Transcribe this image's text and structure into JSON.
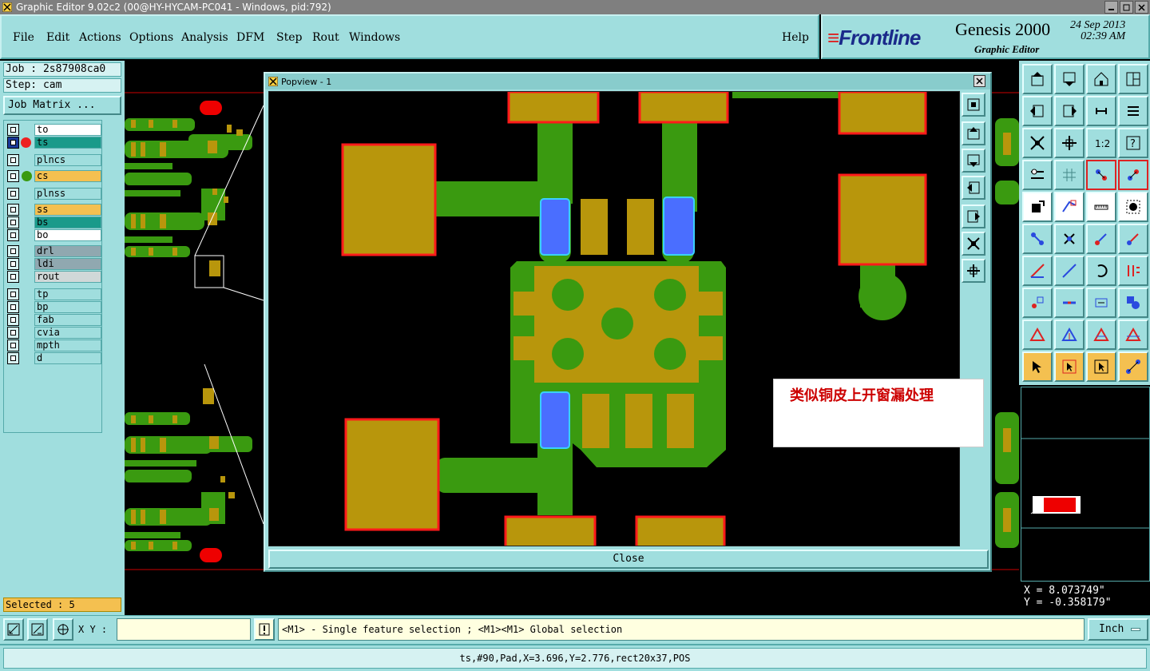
{
  "window": {
    "title": "Graphic Editor 9.02c2 (00@HY-HYCAM-PC041 - Windows, pid:792)"
  },
  "menu": {
    "items": [
      "File",
      "Edit",
      "Actions",
      "Options",
      "Analysis",
      "DFM",
      "Step",
      "Rout",
      "Windows"
    ],
    "help": "Help"
  },
  "brand": {
    "logo": "Frontline",
    "product": "Genesis 2000",
    "date": "24 Sep 2013",
    "time": "02:39 AM",
    "subtitle": "Graphic Editor"
  },
  "job": {
    "job_label": "Job : 2s87908ca0",
    "step_label": "Step: cam",
    "matrix_button": "Job Matrix ..."
  },
  "layers": [
    {
      "name": "to",
      "color": "#ffffff"
    },
    {
      "name": "ts",
      "color": "#1a9a8a",
      "active": true
    },
    {
      "name": "plncs",
      "color": "#a0dede"
    },
    {
      "name": "cs",
      "color": "#f4c050"
    },
    {
      "name": "plnss",
      "color": "#a0dede"
    },
    {
      "name": "ss",
      "color": "#f4c050"
    },
    {
      "name": "bs",
      "color": "#1a9a8a"
    },
    {
      "name": "bo",
      "color": "#ffffff"
    },
    {
      "name": "drl",
      "color": "#90a8b0"
    },
    {
      "name": "ldi",
      "color": "#90a8b0"
    },
    {
      "name": "rout",
      "color": "#d0d8d8"
    },
    {
      "name": "tp",
      "color": "#a0dede"
    },
    {
      "name": "bp",
      "color": "#a0dede"
    },
    {
      "name": "fab",
      "color": "#a0dede"
    },
    {
      "name": "cvia",
      "color": "#a0dede"
    },
    {
      "name": "mpth",
      "color": "#a0dede"
    },
    {
      "name": "d",
      "color": "#a0dede"
    }
  ],
  "selected": "Selected : 5",
  "popup": {
    "title": "Popview - 1",
    "close_label": "Close"
  },
  "note": "类似铜皮上开窗漏处理",
  "coords": {
    "x": "X = 8.073749\"",
    "y": "Y = -0.358179\""
  },
  "bottom": {
    "xy_label": "X Y :",
    "xy_value": "",
    "hint": "<M1> - Single feature selection ; <M1><M1> Global selection",
    "unit": "Inch"
  },
  "status": "ts,#90,Pad,X=3.696,Y=2.776,rect20x37,POS",
  "colors": {
    "panel": "#a0dede",
    "copper": "#b8960c",
    "mask": "#3a9a10",
    "outline": "#ff1a1a",
    "window": "#4a6eff"
  }
}
